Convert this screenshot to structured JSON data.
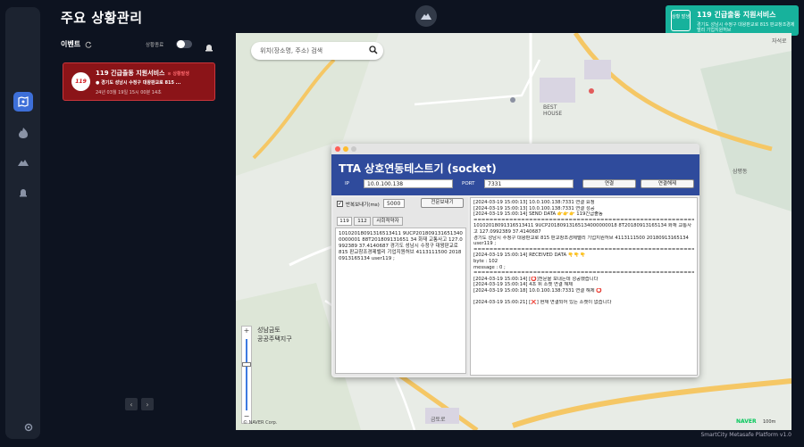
{
  "page_title": "주요 상황관리",
  "toast": {
    "badge": "상황 발생",
    "title": "119 긴급출동 지원서비스",
    "address": "경기도 성남시 수정구 대왕판교로 815 판교창조경제밸리 기업지원허브"
  },
  "events": {
    "title": "이벤트",
    "toggle_label": "상황종료"
  },
  "card": {
    "logo": "119",
    "title": "119 긴급출동 지원서비스",
    "status": "상황발생",
    "address": "경기도 성남시 수정구 대왕판교로 815 ...",
    "time": "24년 03월 19일 15시 00분 14초"
  },
  "pager": {
    "prev": "‹",
    "next": "›"
  },
  "map": {
    "search_placeholder": "위치(장소명, 주소) 검색",
    "labels": {
      "best_house": "BEST\nHOUSE",
      "district": "성남금토\n공공주택지구",
      "road": "금토로",
      "cross": "자석로",
      "east": "삼평동",
      "naver": "NAVER",
      "scale": "100m",
      "credits": "© NAVER Corp."
    }
  },
  "tester": {
    "title": "TTA 상호연동테스트기 (socket)",
    "ip_label": "IP",
    "ip_value": "10.0.100.138",
    "port_label": "PORT",
    "port_value": "7331",
    "connect_label": "연결",
    "disconnect_label": "연결해제",
    "repeat_label": "반복보내기(ms)",
    "repeat_value": "5000",
    "send_label": "전문보내기",
    "tabs": [
      "119",
      "112",
      "사회적약자"
    ],
    "payload": "10102018091316513411 9UCP2018091316513400000001 88T201809131651 34 화재 교통사고 127.0992389 37.4140687 경기도 성남시 수정구 대왕판교로 815 판교창조경제밸리 기업지원허브 4113111500 20180913165134 user119 ;",
    "log": [
      "[2024-03-19 15:00:13] 10.0.100.138:7331 연결 요청",
      "[2024-03-19 15:00:13] 10.0.100.138:7331 연결 성공",
      "[2024-03-19 15:00:14] SEND DATA 👉👉👉 119긴급출동",
      "===============================================================",
      "10102018091316513411 9UCP20180913165134000000018 8T20180913165134 화재 교통사고 127.0992389 37.4140687",
      "경기도 성남시 수정구 대왕판교로 815 판교창조경제밸리 기업지원허브 4113111500 20180913165134 user119 ;",
      "===============================================================",
      "[2024-03-19 15:00:14] RECEIVED DATA 👇👇👇",
      "byte : 102",
      "message : 0                                                                              ;",
      "===============================================================",
      "[2024-03-19 15:00:14] [⭕]전문을 보내는데 성공했습니다",
      "[2024-03-19 15:00:14] 4초 뒤 소켓 연결 해제",
      "[2024-03-19 15:00:18] 10.0.100.138:7331 연결 해제 ⭕",
      "",
      "[2024-03-19 15:00:21] [❌] 현재 연결되어 있는 소켓이 없습니다"
    ]
  },
  "footer": "SmartCity Metasafe Platform v1.0",
  "colors": {
    "accent": "#3d6fd8",
    "toast": "#17b29c",
    "card_bg": "#8b1418",
    "window_header": "#2f4b9c"
  }
}
